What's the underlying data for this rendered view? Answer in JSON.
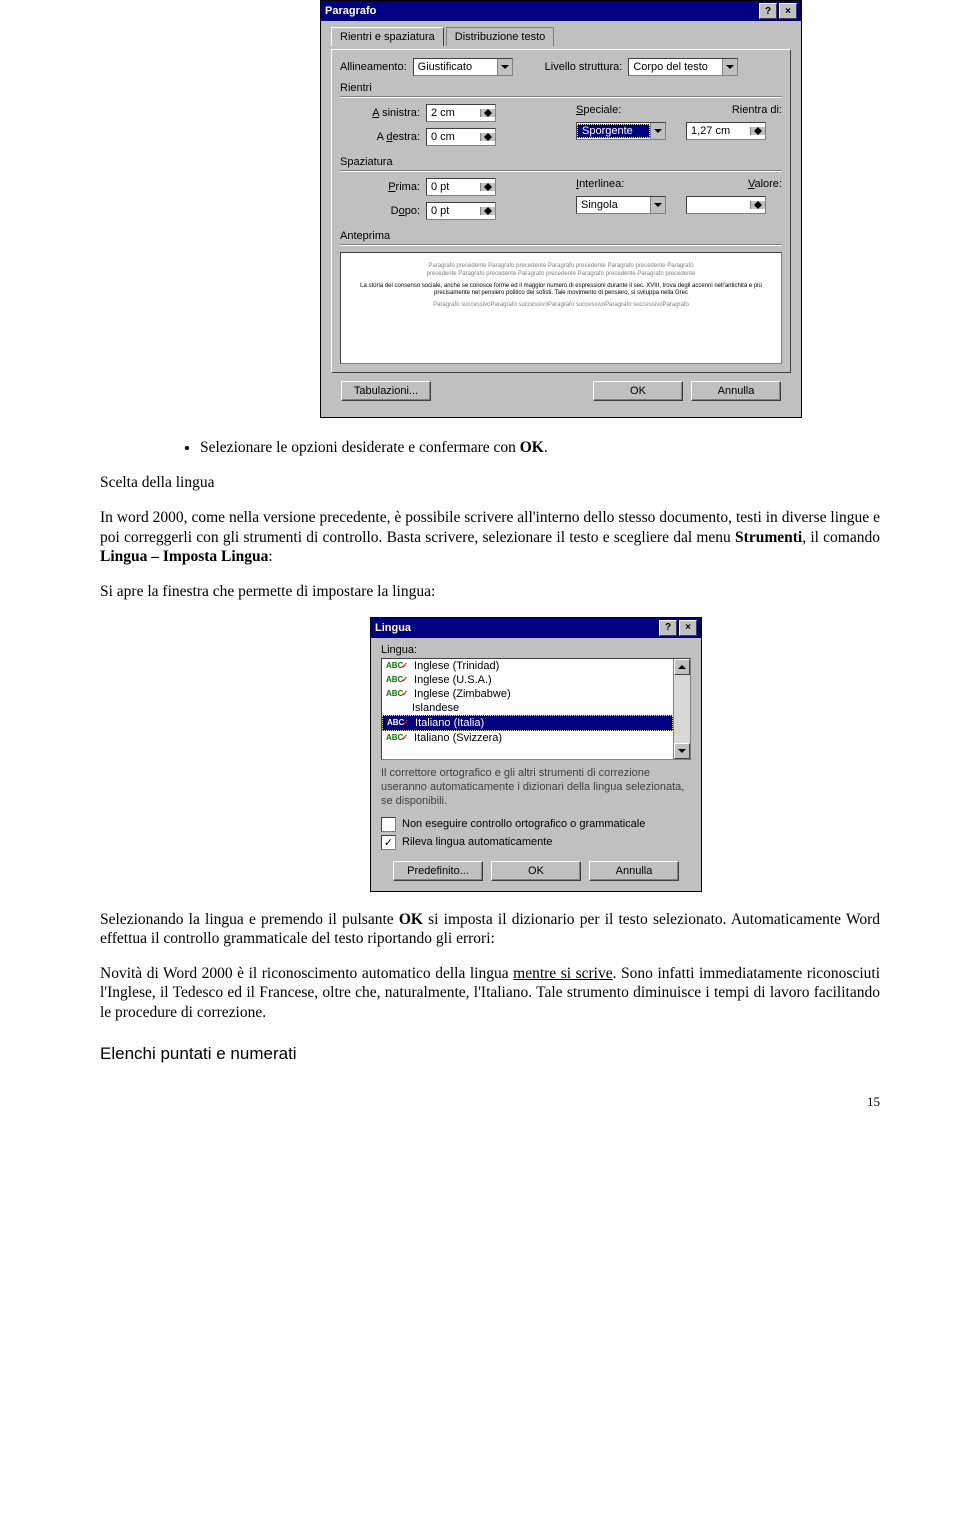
{
  "paragrafo_dialog": {
    "title": "Paragrafo",
    "tabs": {
      "active": "Rientri e spaziatura",
      "inactive": "Distribuzione testo"
    },
    "allineamento_label": "Allineamento:",
    "allineamento_value": "Giustificato",
    "livello_label": "Livello struttura:",
    "livello_value": "Corpo del testo",
    "rientri_title": "Rientri",
    "a_sinistra_label": "A sinistra:",
    "a_sinistra_value": "2 cm",
    "a_destra_label": "A destra:",
    "a_destra_value": "0 cm",
    "speciale_label": "Speciale:",
    "speciale_value": "Sporgente",
    "rientra_di_label": "Rientra di:",
    "rientra_di_value": "1,27 cm",
    "spaziatura_title": "Spaziatura",
    "prima_label": "Prima:",
    "prima_value": "0 pt",
    "dopo_label": "Dopo:",
    "dopo_value": "0 pt",
    "interlinea_label": "Interlinea:",
    "interlinea_value": "Singola",
    "valore_label": "Valore:",
    "valore_value": "",
    "anteprima_title": "Anteprima",
    "preview_line1": "Paragrafo precedente Paragrafo precedente Paragrafo precedente Paragrafo precedente Paragrafo",
    "preview_line2": "precedente Paragrafo precedente Paragrafo precedente Paragrafo precedente Paragrafo precedente",
    "preview_sample": "La storia del consenso sociale, anche se conosce forme ed il maggior numero di espressioni durante il sec. XVIII, trova degli accenni nell'antichità e più precisamente nel pensiero politico dei sofisti. Tale movimento di pensiero, si sviluppa nella Grec",
    "preview_line3": "Paragrafo successivoParagrafo successivoParagrafo successivoParagrafo successivoParagrafo",
    "tabulazioni_btn": "Tabulazioni...",
    "ok_btn": "OK",
    "annulla_btn": "Annulla"
  },
  "bullet1": "Selezionare le opzioni desiderate e confermare con ",
  "bullet1_ok": "OK",
  "bullet1_end": ".",
  "scelta_heading": "Scelta della lingua",
  "para1a": "In word 2000, come nella versione precedente, è possibile scrivere all'interno dello stesso documento, testi in diverse lingue e poi correggerli con gli strumenti di controllo. Basta scrivere, selezionare il testo e scegliere dal menu ",
  "para1_b_strumenti": "Strumenti",
  "para1_mid": ", il comando ",
  "para1_b_lingua": "Lingua – Imposta Lingua",
  "para1_colon": ":",
  "para2": "Si apre la finestra che permette di impostare la lingua:",
  "lingua_dialog": {
    "title": "Lingua",
    "label": "Lingua:",
    "items": [
      "Inglese (Trinidad)",
      "Inglese (U.S.A.)",
      "Inglese (Zimbabwe)",
      "Islandese",
      "Italiano (Italia)",
      "Italiano (Svizzera)"
    ],
    "help": "Il correttore ortografico e gli altri strumenti di correzione useranno automaticamente i dizionari della lingua selezionata, se disponibili.",
    "cb1": "Non eseguire controllo ortografico o grammaticale",
    "cb1_checked": false,
    "cb2": "Rileva lingua automaticamente",
    "cb2_checked": true,
    "predef_btn": "Predefinito...",
    "ok_btn": "OK",
    "annulla_btn": "Annulla"
  },
  "para3a": "Selezionando la lingua e premendo il pulsante ",
  "para3_ok": "OK",
  "para3b": " si imposta il dizionario per il testo selezionato. Automaticamente Word effettua il controllo grammaticale del testo riportando gli errori:",
  "para4a": "Novità di Word 2000 è il riconoscimento automatico della lingua ",
  "para4_u": "mentre si scrive",
  "para4b": ". Sono infatti immediatamente riconosciuti l'Inglese, il Tedesco ed il Francese, oltre che, naturalmente, l'Italiano. Tale strumento diminuisce i tempi di lavoro facilitando le procedure di correzione.",
  "section_head": "Elenchi puntati e numerati",
  "page_number": "15"
}
